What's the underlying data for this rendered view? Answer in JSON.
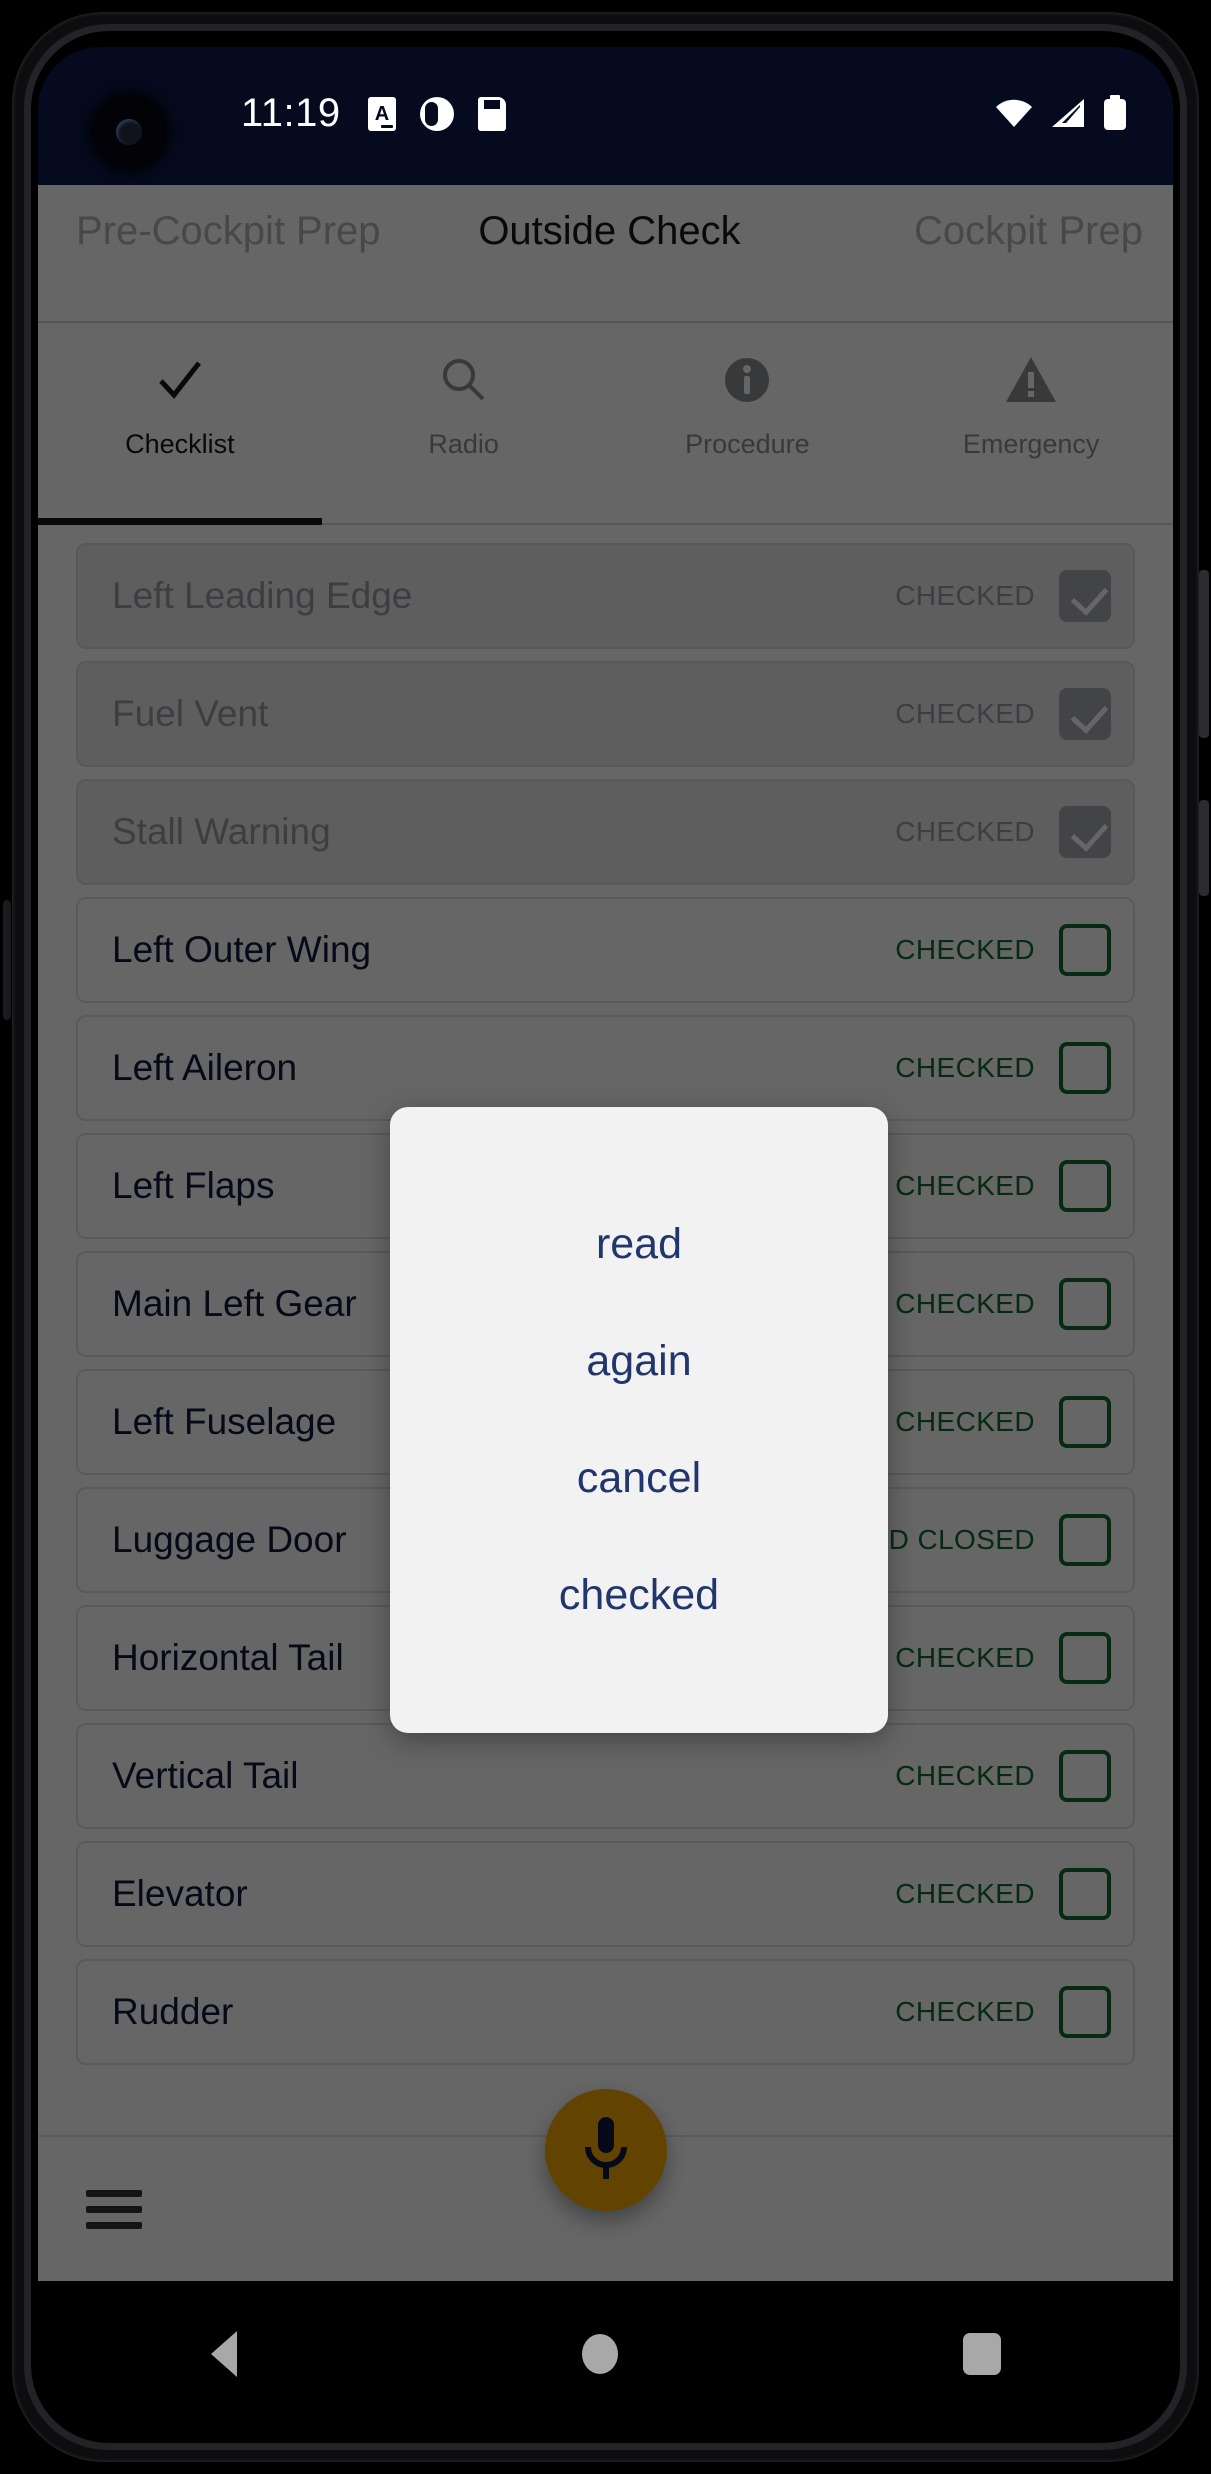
{
  "status_bar": {
    "time": "11:19",
    "notification_icons": [
      "document-a-icon",
      "contrast-circle-icon",
      "sd-card-icon"
    ],
    "system_icons": [
      "wifi-icon",
      "cellular-signal-icon",
      "battery-icon"
    ],
    "background_color": "#050a1e"
  },
  "section_tabs": [
    {
      "label": "Pre-Cockpit Prep",
      "active": false
    },
    {
      "label": "Outside Check",
      "active": true
    },
    {
      "label": "Cockpit Prep",
      "active": false
    }
  ],
  "icon_tabs": [
    {
      "label": "Checklist",
      "icon": "checkmark-icon",
      "active": true
    },
    {
      "label": "Radio",
      "icon": "search-icon",
      "active": false
    },
    {
      "label": "Procedure",
      "icon": "info-circle-icon",
      "active": false
    },
    {
      "label": "Emergency",
      "icon": "warning-triangle-icon",
      "active": false
    }
  ],
  "checklist": {
    "items": [
      {
        "label": "Left Leading Edge",
        "status": "CHECKED",
        "done": true
      },
      {
        "label": "Fuel Vent",
        "status": "CHECKED",
        "done": true
      },
      {
        "label": "Stall Warning",
        "status": "CHECKED",
        "done": true
      },
      {
        "label": "Left Outer Wing",
        "status": "CHECKED",
        "done": false
      },
      {
        "label": "Left Aileron",
        "status": "CHECKED",
        "done": false
      },
      {
        "label": "Left Flaps",
        "status": "CHECKED",
        "done": false
      },
      {
        "label": "Main Left Gear",
        "status": "CHECKED",
        "done": false
      },
      {
        "label": "Left Fuselage",
        "status": "CHECKED",
        "done": false
      },
      {
        "label": "Luggage Door",
        "status": "CHECKED AND CLOSED",
        "done": false
      },
      {
        "label": "Horizontal Tail",
        "status": "CHECKED",
        "done": false
      },
      {
        "label": "Vertical Tail",
        "status": "CHECKED",
        "done": false
      },
      {
        "label": "Elevator",
        "status": "CHECKED",
        "done": false
      },
      {
        "label": "Rudder",
        "status": "CHECKED",
        "done": false
      }
    ]
  },
  "dialog": {
    "options": [
      {
        "label": "read"
      },
      {
        "label": "again"
      },
      {
        "label": "cancel"
      },
      {
        "label": "checked"
      }
    ],
    "text_color": "#22366e",
    "background_color": "#f2f2f3"
  },
  "bottom_bar": {
    "menu_icon": "hamburger-menu-icon",
    "mic_icon": "microphone-icon",
    "mic_color": "#f7a800"
  },
  "nav_bar": {
    "buttons": [
      "back-icon",
      "home-icon",
      "recents-icon"
    ]
  },
  "colors": {
    "status_green": "#13692e",
    "label_navy": "#0f1a3c",
    "disabled_gray": "#9a9ca3"
  }
}
